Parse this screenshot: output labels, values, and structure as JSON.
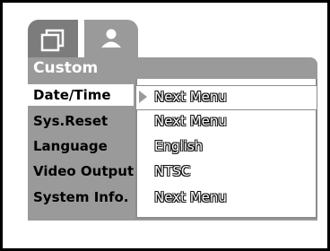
{
  "tabs": [
    {
      "icon": "camera-mode-icon"
    },
    {
      "icon": "setup-person-icon"
    }
  ],
  "header": {
    "title": "Custom"
  },
  "menu": {
    "items": [
      {
        "label": "Date/Time",
        "value": "Next Menu",
        "selected": true
      },
      {
        "label": "Sys.Reset",
        "value": "Next Menu"
      },
      {
        "label": "Language",
        "value": "English"
      },
      {
        "label": "Video Output",
        "value": "NTSC"
      },
      {
        "label": "System Info.",
        "value": "Next Menu"
      }
    ]
  }
}
